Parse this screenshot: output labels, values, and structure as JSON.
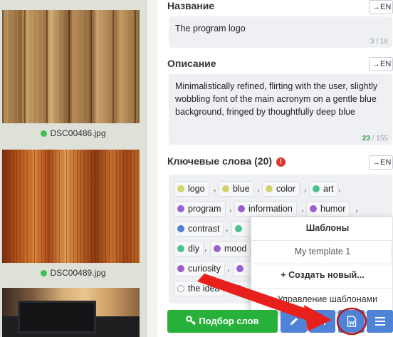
{
  "left_panel": {
    "thumbnails": [
      {
        "caption": "DSC00486.jpg"
      },
      {
        "caption": "DSC00489.jpg"
      }
    ]
  },
  "title_section": {
    "label": "Название",
    "lang_button": "→EN",
    "value": "The program logo",
    "counter": "3 / 16"
  },
  "description_section": {
    "label": "Описание",
    "lang_button": "→EN",
    "value": "Minimalistically refined, flirting with the user, slightly wobbling font of the main acronym on a gentle blue background, fringed by thoughtfully deep blue",
    "counter_used": "23",
    "counter_total": "/ 155"
  },
  "keywords_section": {
    "label": "Ключевые слова (20)",
    "warning_icon": "!",
    "lang_button": "→EN",
    "keywords": [
      {
        "text": "logo",
        "color": "#d4d36a"
      },
      {
        "text": "blue",
        "color": "#d4d36a"
      },
      {
        "text": "color",
        "color": "#d4d36a"
      },
      {
        "text": "art",
        "color": "#4cc28e"
      },
      {
        "text": "program",
        "color": "#9b5fd0"
      },
      {
        "text": "information",
        "color": "#9b5fd0"
      },
      {
        "text": "humor",
        "color": "#9b5fd0"
      },
      {
        "text": "contrast",
        "color": "#4f7fd6"
      },
      {
        "text": "diy",
        "color": "#4cc28e"
      },
      {
        "text": "mood",
        "color": "#9b5fd0"
      },
      {
        "text": "curiosity",
        "color": "#9b5fd0"
      },
      {
        "text": "the idea",
        "color": "hollow"
      }
    ],
    "comma": ","
  },
  "templates_popup": {
    "title": "Шаблоны",
    "items": [
      "My template 1"
    ],
    "create": "+ Создать новый...",
    "manage": "Управление шаблонами"
  },
  "toolbar": {
    "pick_words": "Подбор слов",
    "icons": [
      "key-icon",
      "pencil-icon",
      "sort-icon",
      "word-document-icon",
      "menu-icon"
    ]
  }
}
